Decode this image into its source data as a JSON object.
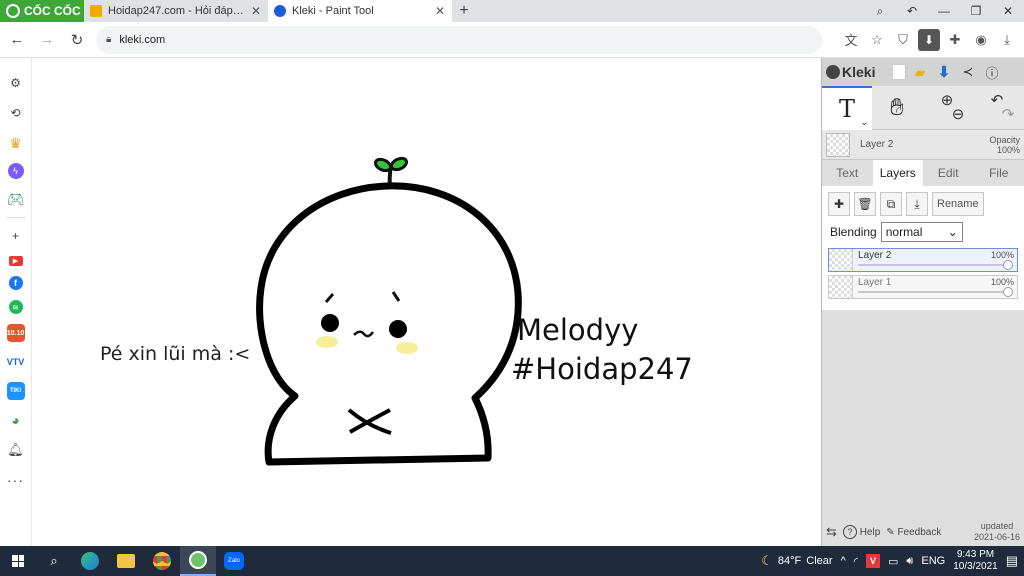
{
  "browser": {
    "brand": "CỐC CỐC",
    "tabs": [
      {
        "title": "Hoidap247.com - Hỏi đáp on",
        "favicon_color": "#f2a900"
      },
      {
        "title": "Kleki - Paint Tool",
        "favicon_color": "#1e5bd8"
      }
    ],
    "url": "kleki.com",
    "icons": [
      "translate-icon",
      "star-icon",
      "shield-icon",
      "download-icon",
      "extensions-icon",
      "profile-icon",
      "save-icon"
    ]
  },
  "sidebar": {
    "items": [
      "settings-icon",
      "history-icon",
      "crown-icon",
      "messenger-icon",
      "game-icon",
      "add-icon",
      "youtube-icon",
      "facebook-icon",
      "spotify-icon",
      "shop-icon",
      "vtv-icon",
      "tiki-icon",
      "coccoc-icon",
      "bell-icon",
      "more-icon"
    ],
    "shop_label": "10.10",
    "vtv_label": "VTV",
    "tiki_label": "TIKI"
  },
  "canvas": {
    "left_text": "Pé xin lũi mà :<",
    "name_text": "Melodyy",
    "hashtag_text": "#Hoidap247"
  },
  "kleki": {
    "app_name": "Kleki",
    "tool_text_glyph": "T",
    "current_layer": "Layer 2",
    "opacity_label": "Opacity",
    "opacity_value": "100%",
    "tabs": [
      "Text",
      "Layers",
      "Edit",
      "File"
    ],
    "active_tab": "Layers",
    "rename_label": "Rename",
    "blending_label": "Blending",
    "blending_value": "normal",
    "layers": [
      {
        "name": "Layer 2",
        "opacity": "100%",
        "active": true
      },
      {
        "name": "Layer 1",
        "opacity": "100%",
        "active": false
      }
    ],
    "help_label": "Help",
    "feedback_label": "Feedback",
    "updated_label": "updated",
    "updated_date": "2021-06-16"
  },
  "taskbar": {
    "apps": [
      "search-icon",
      "edge-icon",
      "file-explorer-icon",
      "chrome-icon",
      "coccoc-icon",
      "zalo-icon"
    ],
    "zalo_label": "Zalo",
    "temperature": "84°F",
    "weather": "Clear",
    "language": "ENG",
    "time": "9:43 PM",
    "date": "10/3/2021"
  },
  "colors": {
    "accent": "#3fa63a",
    "kleki_blue": "#3a6fd8",
    "taskbar": "#1f2b3c",
    "sprout": "#36c43a",
    "cheek": "#f7ee9a"
  }
}
